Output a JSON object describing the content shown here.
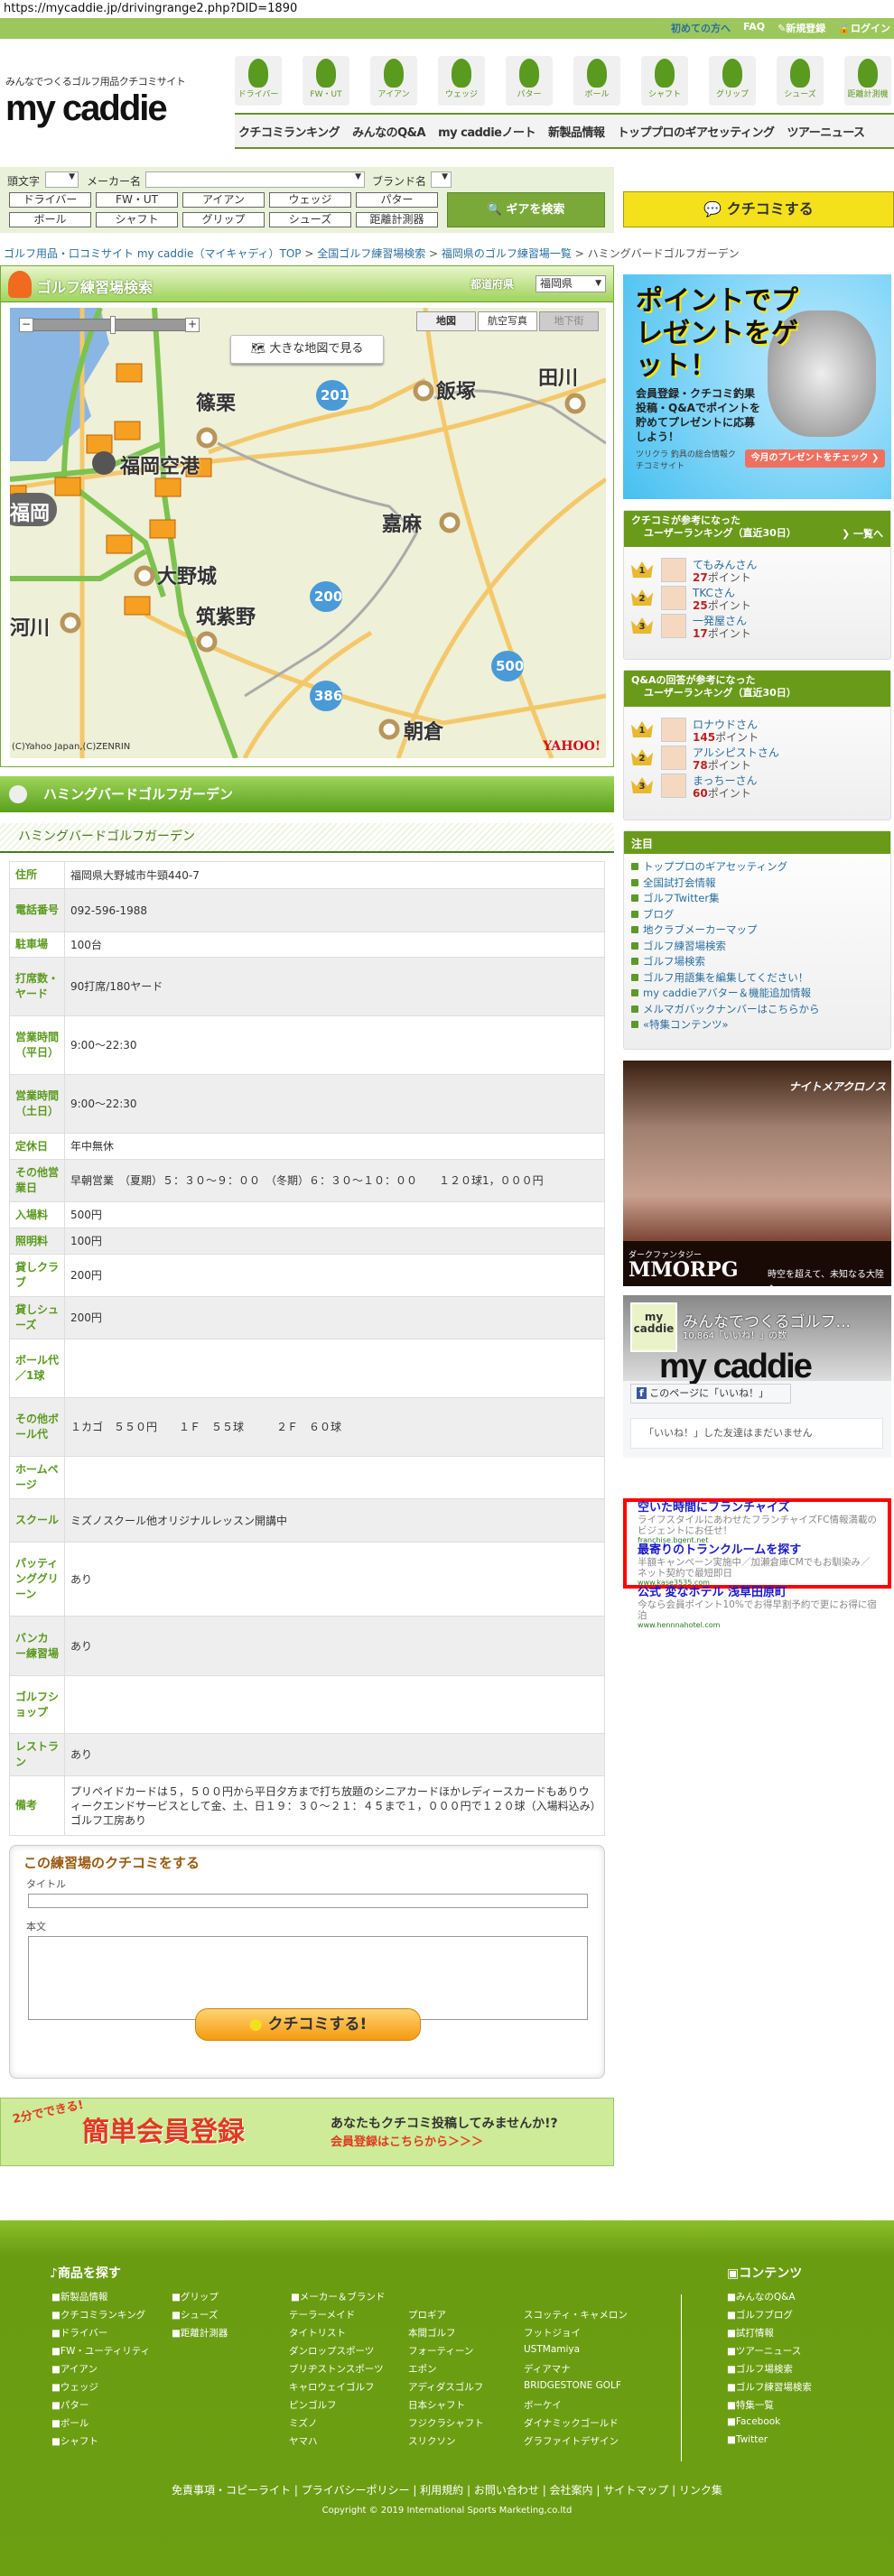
{
  "url": "https://mycaddie.jp/drivingrange2.php?DID=1890",
  "toplinks": [
    "初めての方へ",
    "FAQ",
    "✎新規登録",
    "🔒ログイン"
  ],
  "logo": {
    "tagline": "みんなでつくるゴルフ用品クチコミサイト",
    "name": "my caddie"
  },
  "nav_icons": [
    "ドライバー",
    "FW・UT",
    "アイアン",
    "ウェッジ",
    "パター",
    "ボール",
    "シャフト",
    "グリップ",
    "シューズ",
    "距離計測機"
  ],
  "main_nav": [
    "クチコミランキング",
    "みんなのQ&A",
    "my caddieノート",
    "新製品情報",
    "トッププロのギアセッティング",
    "ツアーニュース"
  ],
  "search": {
    "initial_label": "頭文字",
    "maker_label": "メーカー名",
    "brand_label": "ブランド名",
    "buttons": [
      "ドライバー",
      "FW・UT",
      "アイアン",
      "ウェッジ",
      "パター",
      "ボール",
      "シャフト",
      "グリップ",
      "シューズ",
      "距離計測器"
    ],
    "submit": "ギアを検索"
  },
  "kuchikomi_button": "クチコミする",
  "breadcrumb": [
    {
      "label": "ゴルフ用品・口コミサイト my caddie（マイキャディ）TOP"
    },
    {
      "label": "全国ゴルフ練習場検索"
    },
    {
      "label": "福岡県のゴルフ練習場一覧"
    },
    {
      "label": "ハミングバードゴルフガーデン"
    }
  ],
  "map_section": {
    "title": "ゴルフ練習場検索",
    "pref_label": "都道府県",
    "pref_value": "福岡県",
    "big_map": "大きな地図で見る",
    "types": [
      "地図",
      "航空写真",
      "地下街"
    ],
    "copyright": "(C)Yahoo Japan,(C)ZENRIN",
    "yahoo": "YAHOO!",
    "places": [
      "篠栗",
      "飯塚",
      "田川",
      "福岡空港",
      "嘉麻",
      "大野城",
      "筑紫野",
      "朝倉",
      "河川",
      "福岡"
    ],
    "routes": [
      "201",
      "200",
      "386",
      "500"
    ]
  },
  "range_name": "ハミングバードゴルフガーデン",
  "info_rows": [
    {
      "k": "住所",
      "v": "福岡県大野城市牛頸440-7"
    },
    {
      "k": "電話番号",
      "v": "092-596-1988"
    },
    {
      "k": "駐車場",
      "v": "100台"
    },
    {
      "k": "打席数・ヤード",
      "v": "90打席/180ヤード"
    },
    {
      "k": "営業時間（平日）",
      "v": "9:00～22:30"
    },
    {
      "k": "営業時間（土日）",
      "v": "9:00～22:30"
    },
    {
      "k": "定休日",
      "v": "年中無休"
    },
    {
      "k": "その他営業日",
      "v": "早朝営業　（夏期）５：３０～９：００　（冬期）６：３０～１０：００　　１２０球1，０００円"
    },
    {
      "k": "入場料",
      "v": "500円"
    },
    {
      "k": "照明料",
      "v": "100円"
    },
    {
      "k": "貸しクラブ",
      "v": "200円"
    },
    {
      "k": "貸しシューズ",
      "v": "200円"
    },
    {
      "k": "ボール代／1球",
      "v": ""
    },
    {
      "k": "その他ボール代",
      "v": "１カゴ　５５０円　　１Ｆ　５５球　　　２Ｆ　６０球"
    },
    {
      "k": "ホームページ",
      "v": ""
    },
    {
      "k": "スクール",
      "v": "ミズノスクール他オリジナルレッスン開講中"
    },
    {
      "k": "パッティンググリーン",
      "v": "あり"
    },
    {
      "k": "バンカー練習場",
      "v": "あり"
    },
    {
      "k": "ゴルフショップ",
      "v": ""
    },
    {
      "k": "レストラン",
      "v": "あり"
    },
    {
      "k": "備考",
      "v": "プリペイドカードは５，５００円から平日夕方まで打ち放題のシニアカードほかレディースカードもありウィークエンドサービスとして金、土、日１９：３０～２１：４５まで１，０００円で１２０球（入場料込み）ゴルフ工房あり"
    }
  ],
  "review": {
    "heading": "この練習場のクチコミをする",
    "title_label": "タイトル",
    "body_label": "本文",
    "submit": "クチコミする!"
  },
  "register": {
    "badge": "2分でできる!",
    "title": "簡単会員登録",
    "line1": "あなたもクチコミ投稿してみませんか!?",
    "line2": "会員登録はこちらから＞＞＞"
  },
  "side_ad": {
    "headline": "ポイントでプレゼントをゲット！",
    "desc": "会員登録・クチコミ釣果投稿・Q&Aでポイントを貯めてプレゼントに応募しよう！",
    "brand": "ツリクラ 釣具の総合情報クチコミサイト",
    "cta": "今月のプレゼントをチェック ❯"
  },
  "ranking1": {
    "title1": "クチコミが参考になった",
    "title2": "ユーザーランキング（直近30日）",
    "more": "❯ 一覧へ",
    "unit": "ポイント",
    "users": [
      {
        "rank": "1",
        "name": "てもみんさん",
        "points": "27"
      },
      {
        "rank": "2",
        "name": "TKCさん",
        "points": "25"
      },
      {
        "rank": "3",
        "name": "一発屋さん",
        "points": "17"
      }
    ]
  },
  "ranking2": {
    "title1": "Q&Aの回答が参考になった",
    "title2": "ユーザーランキング（直近30日）",
    "unit": "ポイント",
    "users": [
      {
        "rank": "1",
        "name": "ロナウドさん",
        "points": "145"
      },
      {
        "rank": "2",
        "name": "アルシピストさん",
        "points": "78"
      },
      {
        "rank": "3",
        "name": "まっちーさん",
        "points": "60"
      }
    ]
  },
  "chumoku": {
    "title": "注目",
    "items": [
      "トッププロのギアセッティング",
      "全国試打会情報",
      "ゴルフTwitter集",
      "ブログ",
      "地クラブメーカーマップ",
      "ゴルフ練習場検索",
      "ゴルフ場検索",
      "ゴルフ用語集を編集してください！",
      "my caddieアバター＆機能追加情報",
      "メルマガバックナンバーはこちらから",
      "«特集コンテンツ»"
    ]
  },
  "game_ad": {
    "title": "ナイトメアクロノス",
    "sub": "ダークファンタジー",
    "main": "MMORPG",
    "tag": "時空を超えて、未知なる大陸へ"
  },
  "facebook": {
    "pic": "my caddie",
    "name": "みんなでつくるゴルフ...",
    "count": "10,864「いいね！」の数",
    "cover": "my caddie",
    "like": "このページに「いいね！」",
    "friends": "「いいね！」した友達はまだいません"
  },
  "ads": [
    {
      "title": "空いた時間にフランチャイズ",
      "desc": "ライフスタイルにあわせたフランチャイズFC情報満載のビジェントにお任せ！",
      "url": "franchise.bgent.net"
    },
    {
      "title": "最寄りのトランクルームを探す",
      "desc": "半額キャンペーン実施中／加瀬倉庫CMでもお馴染み／ネット契約で最短即日",
      "url": "www.kase3535.com"
    },
    {
      "title": "公式 変なホテル 浅草田原町",
      "desc": "今なら会員ポイント10%でお得早割予約で更にお得に宿泊",
      "url": "www.hennnahotel.com"
    }
  ],
  "footer": {
    "products_title": "商品を探す",
    "contents_title": "コンテンツ",
    "col1": [
      "■新製品情報",
      "■クチコミランキング",
      "■ドライバー",
      "■FW・ユーティリティ",
      "■アイアン",
      "■ウェッジ",
      "■パター",
      "■ボール",
      "■シャフト"
    ],
    "col2": [
      "■グリップ",
      "■シューズ",
      "■距離計測器"
    ],
    "maker_title": "■メーカー＆ブランド",
    "makers_a": [
      "テーラーメイド",
      "タイトリスト",
      "ダンロップスポーツ",
      "ブリヂストンスポーツ",
      "キャロウェイゴルフ",
      "ピンゴルフ",
      "ミズノ",
      "ヤマハ"
    ],
    "makers_b": [
      "プロギア",
      "本間ゴルフ",
      "フォーティーン",
      "エポン",
      "アディダスゴルフ",
      "日本シャフト",
      "フジクラシャフト",
      "スリクソン"
    ],
    "makers_c": [
      "スコッティ・キャメロン",
      "フットジョイ",
      "USTMamiya",
      "ディアマナ",
      "BRIDGESTONE GOLF",
      "ボーケイ",
      "ダイナミックゴールド",
      "グラファイトデザイン"
    ],
    "contents": [
      "■みんなのQ&A",
      "■ゴルフブログ",
      "■試打情報",
      "■ツアーニュース",
      "■ゴルフ場検索",
      "■ゴルフ練習場検索",
      "■特集一覧",
      "■Facebook",
      "■Twitter"
    ],
    "links": [
      "免責事項・コピーライト",
      "プライバシーポリシー",
      "利用規約",
      "お問い合わせ",
      "会社案内",
      "サイトマップ",
      "リンク集"
    ],
    "copyright": "Copyright © 2019 International Sports Marketing,co.ltd"
  }
}
